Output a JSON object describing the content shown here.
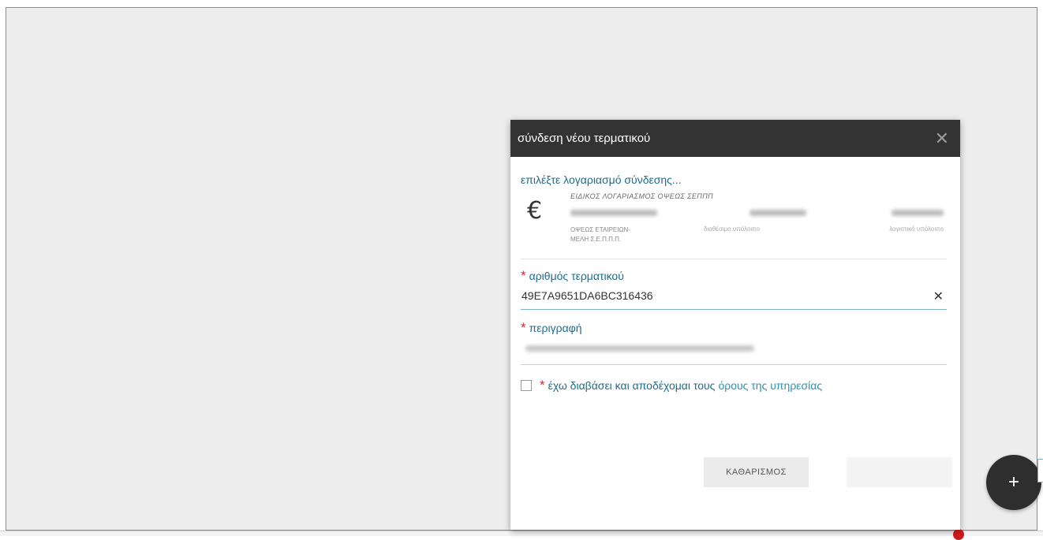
{
  "dialog": {
    "title": "σύνδεση νέου τερματικού",
    "select_account_link": "επιλέξτε λογαριασμό σύνδεσης...",
    "account": {
      "type_label": "ΕΙΔΙΚΟΣ ΛΟΓΑΡΙΑΣΜΟΣ ΟΨΕΩΣ ΣΕΠΠΠ",
      "owner_label": "ΟΨΕΩΣ ΕΤΑΙΡΕΙΩΝ-ΜΕΛΗ Σ.Ε.Π.Π.Π.",
      "available_label": "διαθέσιμο υπόλοιπο",
      "balance_label": "λογιστικό υπόλοιπο",
      "currency_icon": "euro-icon"
    },
    "terminal_field": {
      "label": "αριθμός τερματικού",
      "value": "49E7A9651DA6BC316436"
    },
    "description_field": {
      "label": "περιγραφή"
    },
    "terms": {
      "text": "έχω διαβάσει και αποδέχομαι τους",
      "link_text": "όρους της υπηρεσίας"
    },
    "buttons": {
      "clear_label": "ΚΑΘΑΡΙΣΜΟΣ"
    }
  },
  "icons": {
    "close": "✕",
    "clear": "✕",
    "fab": "+"
  },
  "colors": {
    "header_bg": "#333333",
    "link": "#1f6b8a",
    "required": "#d9262d",
    "fab_bg": "#2e2e2e"
  }
}
